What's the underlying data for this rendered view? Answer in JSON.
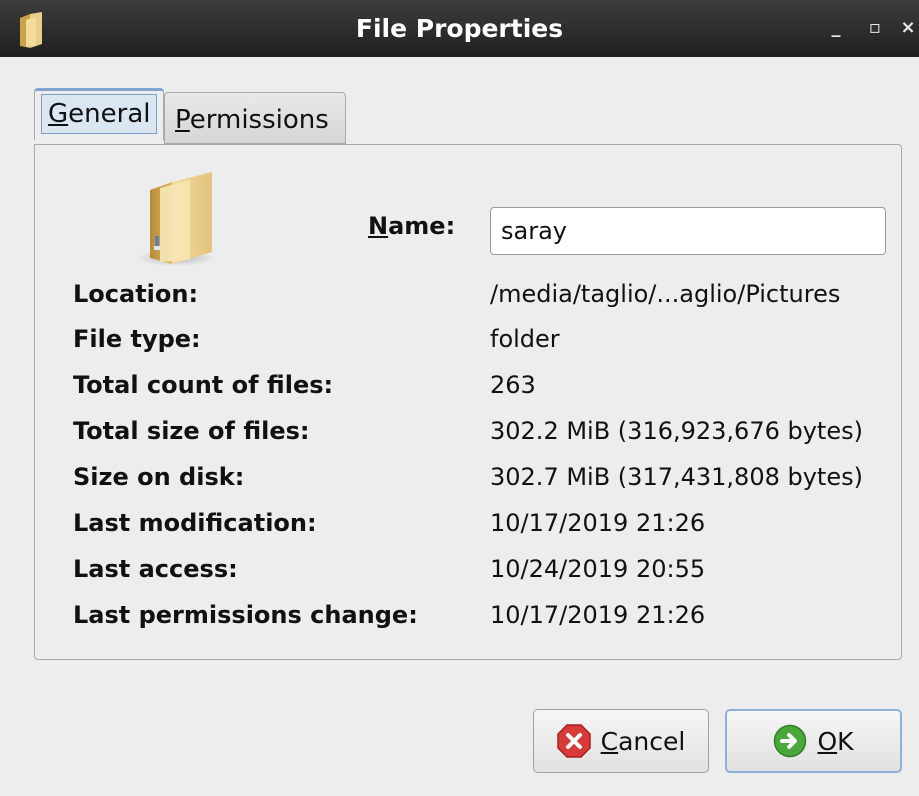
{
  "window": {
    "title": "File Properties",
    "minimize": "_",
    "maximize": "▫",
    "close": "×"
  },
  "tabs": [
    {
      "pre": "",
      "mnemonic": "G",
      "post": "eneral",
      "active": true
    },
    {
      "pre": "",
      "mnemonic": "P",
      "post": "ermissions",
      "active": false
    }
  ],
  "general": {
    "name_label_mnemonic": "N",
    "name_label_rest": "ame:",
    "name_value": "saray",
    "rows": [
      {
        "label": "Location:",
        "value": "/media/taglio/...aglio/Pictures"
      },
      {
        "label": "File type:",
        "value": "folder"
      },
      {
        "label": "Total count of files:",
        "value": "263"
      },
      {
        "label": "Total size of files:",
        "value": "302.2 MiB (316,923,676 bytes)"
      },
      {
        "label": "Size on disk:",
        "value": "302.7 MiB (317,431,808 bytes)"
      },
      {
        "label": "Last modification:",
        "value": "10/17/2019 21:26"
      },
      {
        "label": "Last access:",
        "value": "10/24/2019 20:55"
      },
      {
        "label": "Last permissions change:",
        "value": "10/17/2019 21:26"
      }
    ]
  },
  "buttons": {
    "cancel": {
      "mnemonic": "C",
      "rest": "ancel",
      "icon": "cancel-icon"
    },
    "ok": {
      "mnemonic": "O",
      "rest": "K",
      "icon": "ok-icon"
    }
  },
  "colors": {
    "titlebar": "#2a2a2a",
    "background": "#ededed",
    "tab_accent": "#7ea5d1",
    "cancel_icon": "#d83a3a",
    "ok_icon": "#4aa83a"
  }
}
